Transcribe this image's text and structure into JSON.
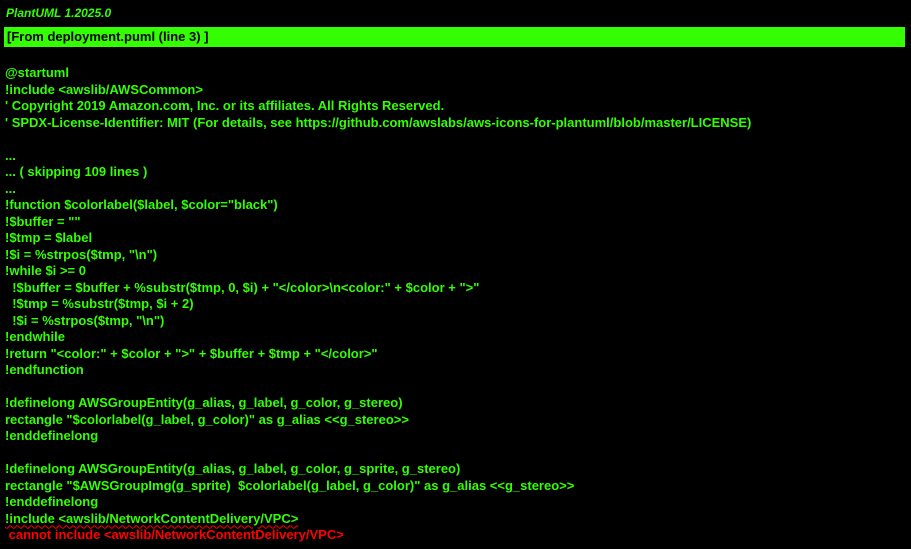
{
  "header": {
    "version": "PlantUML 1.2025.0",
    "banner": "[From deployment.puml (line 3) ]"
  },
  "colors": {
    "background": "#000000",
    "text": "#33FF02",
    "error": "#FF0000"
  },
  "source_lines": [
    "@startuml",
    "!include <awslib/AWSCommon>",
    "' Copyright 2019 Amazon.com, Inc. or its affiliates. All Rights Reserved.",
    "' SPDX-License-Identifier: MIT (For details, see https://github.com/awslabs/aws-icons-for-plantuml/blob/master/LICENSE)",
    "",
    "...",
    "... ( skipping 109 lines )",
    "...",
    "!function $colorlabel($label, $color=\"black\")",
    "!$buffer = \"\"",
    "!$tmp = $label",
    "!$i = %strpos($tmp, \"\\n\")",
    "!while $i >= 0",
    "  !$buffer = $buffer + %substr($tmp, 0, $i) + \"</color>\\n<color:\" + $color + \">\"",
    "  !$tmp = %substr($tmp, $i + 2)",
    "  !$i = %strpos($tmp, \"\\n\")",
    "!endwhile",
    "!return \"<color:\" + $color + \">\" + $buffer + $tmp + \"</color>\"",
    "!endfunction",
    "",
    "!definelong AWSGroupEntity(g_alias, g_label, g_color, g_stereo)",
    "rectangle \"$colorlabel(g_label, g_color)\" as g_alias <<g_stereo>>",
    "!enddefinelong",
    "",
    "!definelong AWSGroupEntity(g_alias, g_label, g_color, g_sprite, g_stereo)",
    "rectangle \"$AWSGroupImg(g_sprite)  $colorlabel(g_label, g_color)\" as g_alias <<g_stereo>>",
    "!enddefinelong"
  ],
  "error": {
    "include_line": "!include <awslib/NetworkContentDelivery/VPC>",
    "message": " cannot include <awslib/NetworkContentDelivery/VPC>"
  }
}
